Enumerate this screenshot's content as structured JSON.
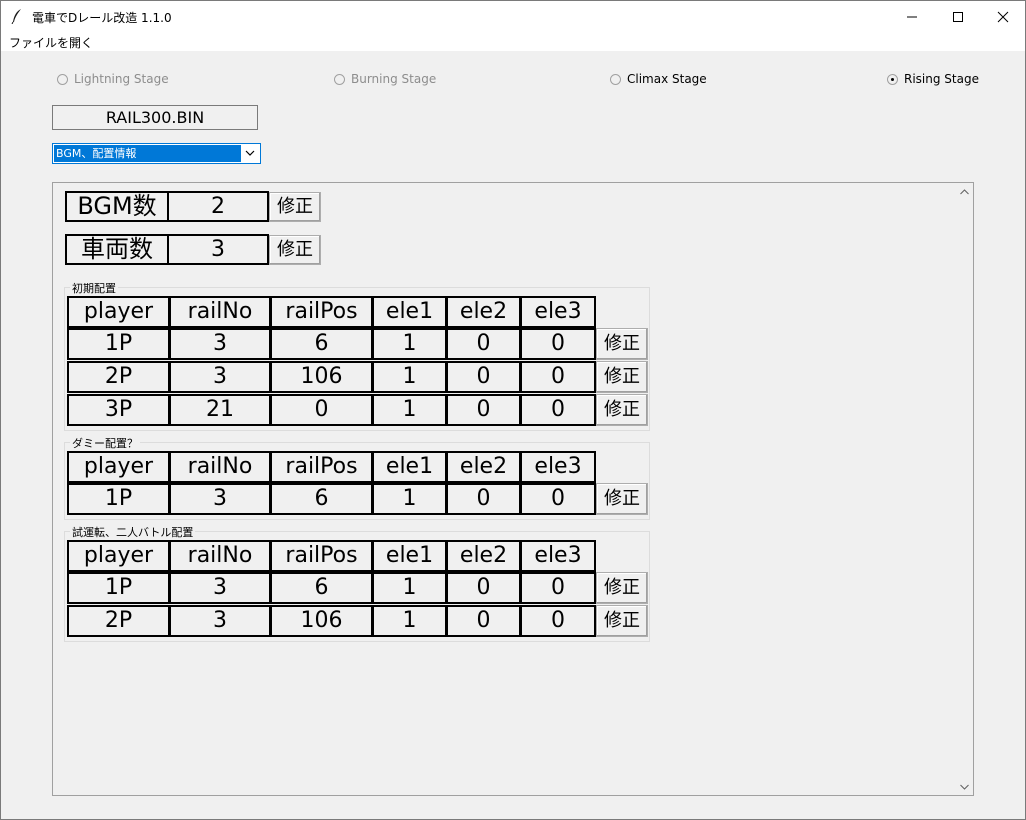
{
  "window": {
    "title": "電車でDレール改造 1.1.0"
  },
  "menu": {
    "file_open": "ファイルを開く"
  },
  "stages": [
    {
      "label": "Lightning Stage",
      "selected": false,
      "enabled": false
    },
    {
      "label": "Burning Stage",
      "selected": false,
      "enabled": false
    },
    {
      "label": "Climax Stage",
      "selected": false,
      "enabled": true
    },
    {
      "label": "Rising Stage",
      "selected": true,
      "enabled": true
    }
  ],
  "filename": "RAIL300.BIN",
  "dropdown": {
    "selected": "BGM、配置情報"
  },
  "bgm": {
    "label": "BGM数",
    "value": "2",
    "button": "修正"
  },
  "cars": {
    "label": "車両数",
    "value": "3",
    "button": "修正"
  },
  "table_headers": [
    "player",
    "railNo",
    "railPos",
    "ele1",
    "ele2",
    "ele3"
  ],
  "groups": [
    {
      "label": "初期配置",
      "rows": [
        [
          "1P",
          "3",
          "6",
          "1",
          "0",
          "0"
        ],
        [
          "2P",
          "3",
          "106",
          "1",
          "0",
          "0"
        ],
        [
          "3P",
          "21",
          "0",
          "1",
          "0",
          "0"
        ]
      ],
      "button": "修正"
    },
    {
      "label": "ダミー配置？",
      "rows": [
        [
          "1P",
          "3",
          "6",
          "1",
          "0",
          "0"
        ]
      ],
      "button": "修正"
    },
    {
      "label": "試運転、二人バトル配置",
      "rows": [
        [
          "1P",
          "3",
          "6",
          "1",
          "0",
          "0"
        ],
        [
          "2P",
          "3",
          "106",
          "1",
          "0",
          "0"
        ]
      ],
      "button": "修正"
    }
  ]
}
